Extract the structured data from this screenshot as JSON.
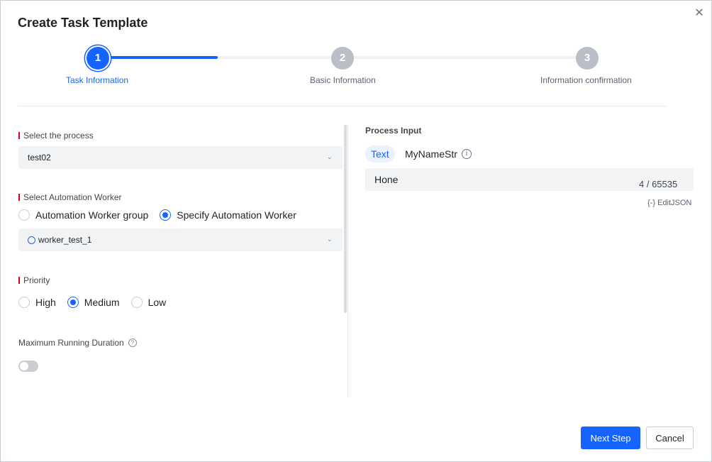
{
  "dialog": {
    "title": "Create Task Template",
    "close_icon": "close-icon"
  },
  "steps": [
    {
      "number": "1",
      "label": "Task Information",
      "status": "active"
    },
    {
      "number": "2",
      "label": "Basic Information",
      "status": "pending"
    },
    {
      "number": "3",
      "label": "Information confirmation",
      "status": "pending"
    }
  ],
  "form": {
    "process": {
      "label": "Select the process",
      "value": "test02"
    },
    "worker": {
      "label": "Select Automation Worker",
      "options": [
        "Automation Worker group",
        "Specify Automation Worker"
      ],
      "selected": "Specify Automation Worker",
      "select_value": "worker_test_1"
    },
    "priority": {
      "label": "Priority",
      "options": [
        "High",
        "Medium",
        "Low"
      ],
      "selected": "Medium"
    },
    "max_duration": {
      "label": "Maximum Running Duration",
      "enabled": false
    }
  },
  "process_input": {
    "title": "Process Input",
    "tabs": [
      "Text",
      "MyNameStr"
    ],
    "value": "Hone",
    "counter": "4 / 65535",
    "edit_json_label": "EditJSON",
    "edit_json_prefix": "{-}"
  },
  "footer": {
    "next_label": "Next Step",
    "cancel_label": "Cancel"
  },
  "colors": {
    "accent": "#1664ff",
    "required": "#d0021b",
    "inactive_step": "#b9bec7"
  }
}
